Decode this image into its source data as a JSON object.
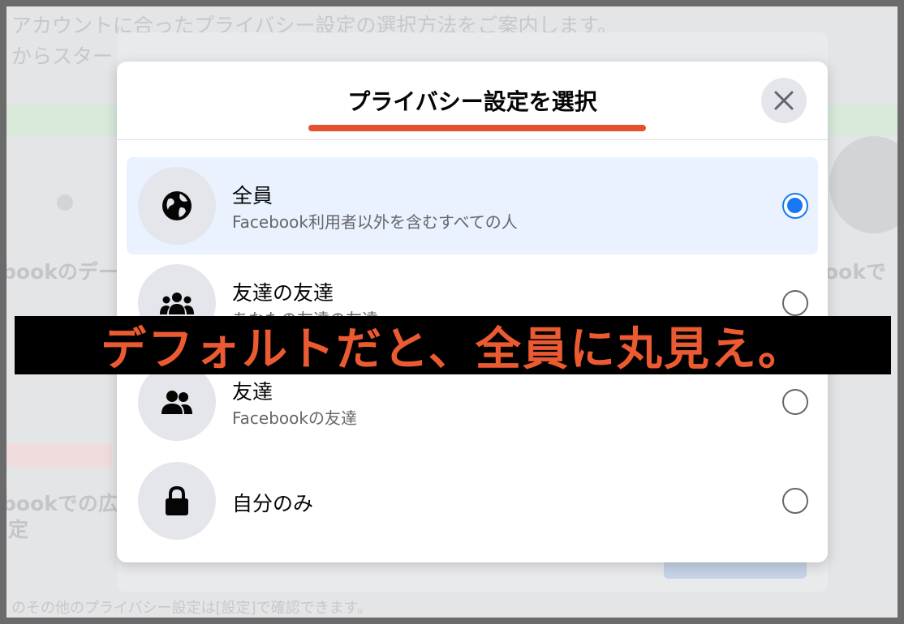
{
  "background": {
    "line1": "アカウントに合ったプライバシー設定の選択方法をご案内します。",
    "line2": "からスター",
    "left_mid": "bookのデー",
    "left_low1": "bookでの広告",
    "left_low2": "定",
    "right_mid": "ookで",
    "bottom": "のその他のプライバシー設定は[設定]で確認できます。"
  },
  "dialog": {
    "title": "プライバシー設定を選択",
    "close_icon": "close-icon",
    "options": [
      {
        "label": "全員",
        "description": "Facebook利用者以外を含むすべての人",
        "icon": "globe-icon",
        "selected": true
      },
      {
        "label": "友達の友達",
        "description": "あなたの友達の友達",
        "icon": "group-icon",
        "selected": false
      },
      {
        "label": "友達",
        "description": "Facebookの友達",
        "icon": "friends-icon",
        "selected": false
      },
      {
        "label": "自分のみ",
        "description": "",
        "icon": "lock-icon",
        "selected": false
      }
    ]
  },
  "banner": {
    "text": "デフォルトだと、全員に丸見え。"
  },
  "colors": {
    "accent": "#1877f2",
    "annotation": "#e4512d",
    "selected_bg": "#e9f2fe"
  }
}
